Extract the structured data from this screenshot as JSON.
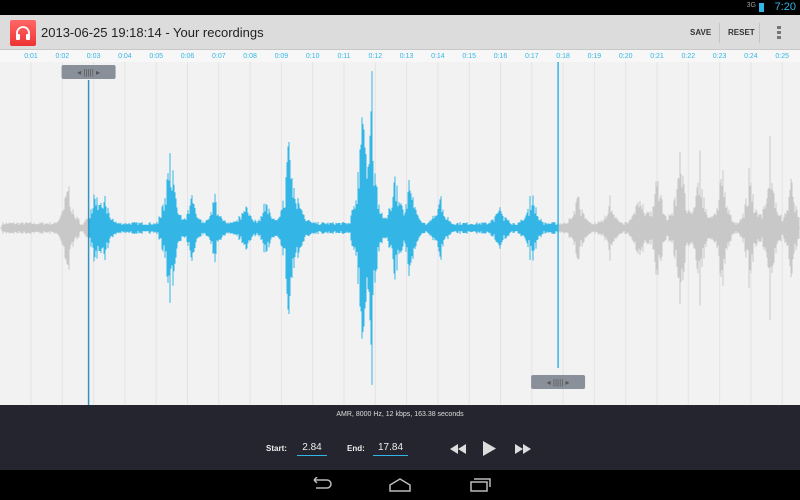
{
  "status": {
    "time": "7:20",
    "network": "3G"
  },
  "actionbar": {
    "title": "2013-06-25 19:18:14 - Your recordings",
    "save": "SAVE",
    "reset": "RESET"
  },
  "timeline": {
    "ticks": [
      "0:01",
      "0:02",
      "0:03",
      "0:04",
      "0:05",
      "0:06",
      "0:07",
      "0:08",
      "0:09",
      "0:10",
      "0:11",
      "0:12",
      "0:13",
      "0:14",
      "0:15",
      "0:16",
      "0:17",
      "0:18",
      "0:19",
      "0:20",
      "0:21",
      "0:22",
      "0:23",
      "0:24",
      "0:25"
    ]
  },
  "selection": {
    "start_seconds": 2.84,
    "end_seconds": 17.84
  },
  "controls": {
    "info": "AMR, 8000 Hz, 12 kbps, 163.38 seconds",
    "start_label": "Start:",
    "start_value": "2.84",
    "end_label": "End:",
    "end_value": "17.84"
  },
  "colors": {
    "accent": "#33b5e5",
    "unselected": "#c8c8c8",
    "controls_bg": "#25252f"
  }
}
